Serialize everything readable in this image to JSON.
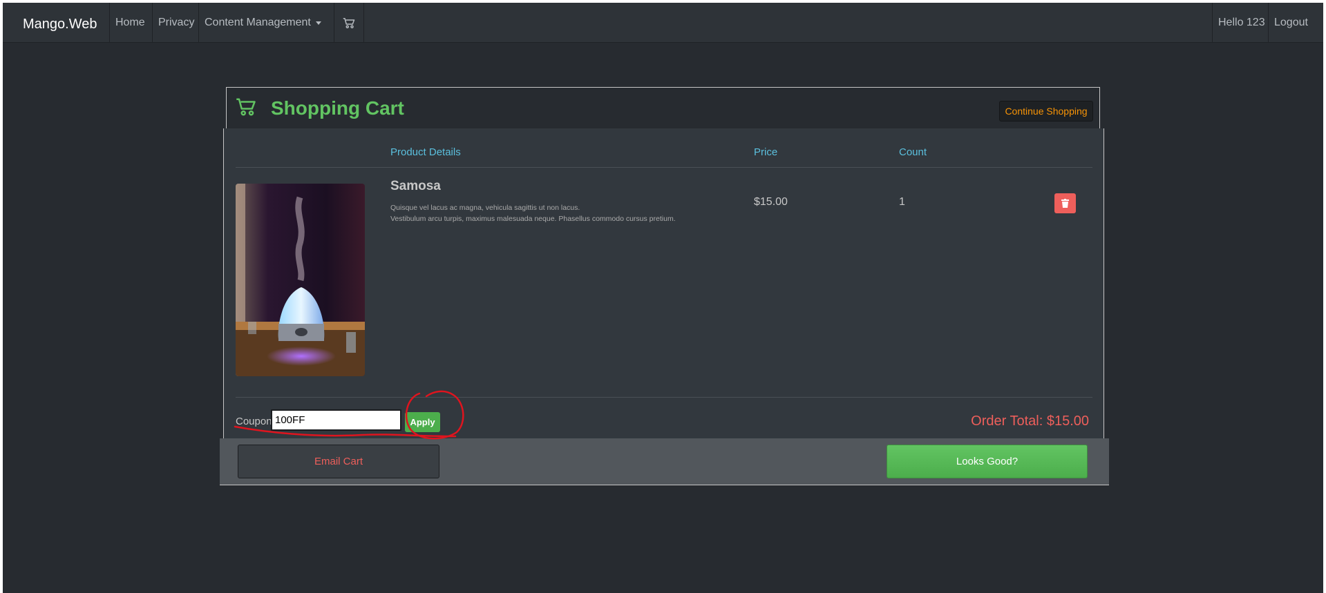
{
  "navbar": {
    "brand": "Mango.Web",
    "items": [
      {
        "label": "Home"
      },
      {
        "label": "Privacy"
      },
      {
        "label": "Content Management"
      }
    ],
    "cart_icon": "cart-icon",
    "user_greeting": "Hello 123",
    "logout": "Logout"
  },
  "cart": {
    "title": "Shopping Cart",
    "continue_label": "Continue Shopping",
    "columns": {
      "details": "Product Details",
      "price": "Price",
      "count": "Count"
    },
    "item": {
      "name": "Samosa",
      "desc_line1": "Quisque vel lacus ac magna, vehicula sagittis ut non lacus.",
      "desc_line2": "Vestibulum arcu turpis, maximus malesuada neque. Phasellus commodo cursus pretium.",
      "price": "$15.00",
      "count": "1",
      "delete_icon": "trash-icon"
    },
    "coupon": {
      "label": "Coupon:",
      "value": "100FF",
      "apply_label": "Apply"
    },
    "order_total": "Order Total: $15.00",
    "email_label": "Email Cart",
    "looks_good_label": "Looks Good?"
  },
  "colors": {
    "accent_green": "#62c462",
    "danger": "#ee5f5b",
    "warning": "#f89406",
    "info": "#5bc0de",
    "annotation": "#e0141e"
  }
}
